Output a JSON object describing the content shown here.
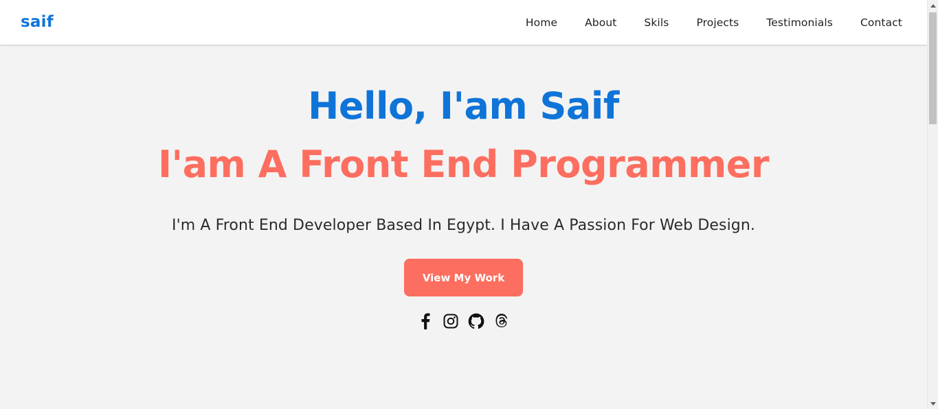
{
  "header": {
    "logo": "saif",
    "nav": [
      {
        "label": "Home"
      },
      {
        "label": "About"
      },
      {
        "label": "Skils"
      },
      {
        "label": "Projects"
      },
      {
        "label": "Testimonials"
      },
      {
        "label": "Contact"
      }
    ]
  },
  "hero": {
    "title": "Hello, I'am Saif",
    "subtitle": "I'am A Front End Programmer",
    "description": "I'm A Front End Developer Based In Egypt. I Have A Passion For Web Design.",
    "cta_label": "View My Work",
    "socials": [
      {
        "icon": "facebook-icon"
      },
      {
        "icon": "instagram-icon"
      },
      {
        "icon": "github-icon"
      },
      {
        "icon": "threads-icon"
      }
    ]
  },
  "colors": {
    "primary_blue": "#0f74d8",
    "accent_coral": "#fc6e5f",
    "hero_background": "#f3f3f3",
    "header_background": "#ffffff",
    "text_dark": "#2a2a2a"
  }
}
